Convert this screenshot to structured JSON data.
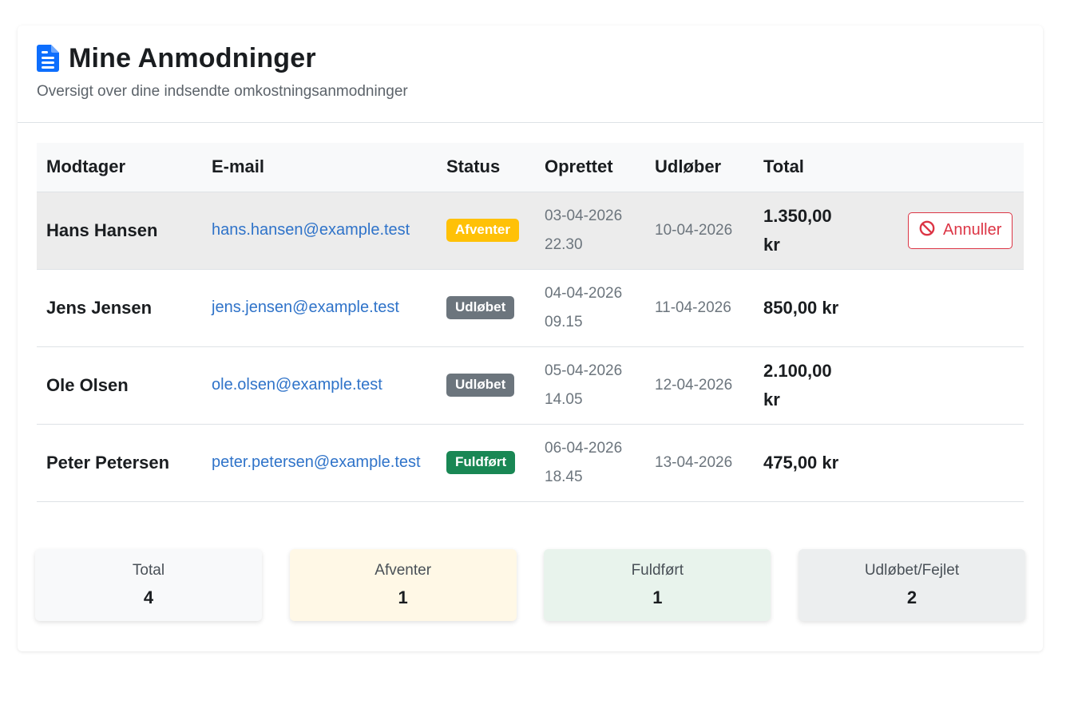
{
  "header": {
    "title": "Mine Anmodninger",
    "subtitle": "Oversigt over dine indsendte omkostningsanmodninger",
    "icon": "document-icon",
    "icon_color": "#0d6efd"
  },
  "table": {
    "columns": [
      "Modtager",
      "E-mail",
      "Status",
      "Oprettet",
      "Udløber",
      "Total"
    ],
    "rows": [
      {
        "recipient": "Hans Hansen",
        "email": "hans.hansen@example.test",
        "status": "Afventer",
        "status_color": "#ffc107",
        "created_date": "03-04-2026",
        "created_time": "22.30",
        "expires": "10-04-2026",
        "total_line1": "1.350,00",
        "total_line2": "kr",
        "action_label": "Annuller"
      },
      {
        "recipient": "Jens Jensen",
        "email": "jens.jensen@example.test",
        "status": "Udløbet",
        "status_color": "#6c757d",
        "created_date": "04-04-2026",
        "created_time": "09.15",
        "expires": "11-04-2026",
        "total_line1": "850,00 kr",
        "total_line2": ""
      },
      {
        "recipient": "Ole Olsen",
        "email": "ole.olsen@example.test",
        "status": "Udløbet",
        "status_color": "#6c757d",
        "created_date": "05-04-2026",
        "created_time": "14.05",
        "expires": "12-04-2026",
        "total_line1": "2.100,00",
        "total_line2": "kr"
      },
      {
        "recipient": "Peter Petersen",
        "email": "peter.petersen@example.test",
        "status": "Fuldført",
        "status_color": "#198754",
        "created_date": "06-04-2026",
        "created_time": "18.45",
        "expires": "13-04-2026",
        "total_line1": "475,00 kr",
        "total_line2": ""
      }
    ]
  },
  "stats": [
    {
      "label": "Total",
      "value": "4",
      "bg": "#f8f9fa"
    },
    {
      "label": "Afventer",
      "value": "1",
      "bg": "#fff8e6"
    },
    {
      "label": "Fuldført",
      "value": "1",
      "bg": "#e8f3ec"
    },
    {
      "label": "Udløbet/Fejlet",
      "value": "2",
      "bg": "#eceeef"
    }
  ],
  "colors": {
    "cancel": "#dc3545",
    "link": "#2f73c9"
  }
}
